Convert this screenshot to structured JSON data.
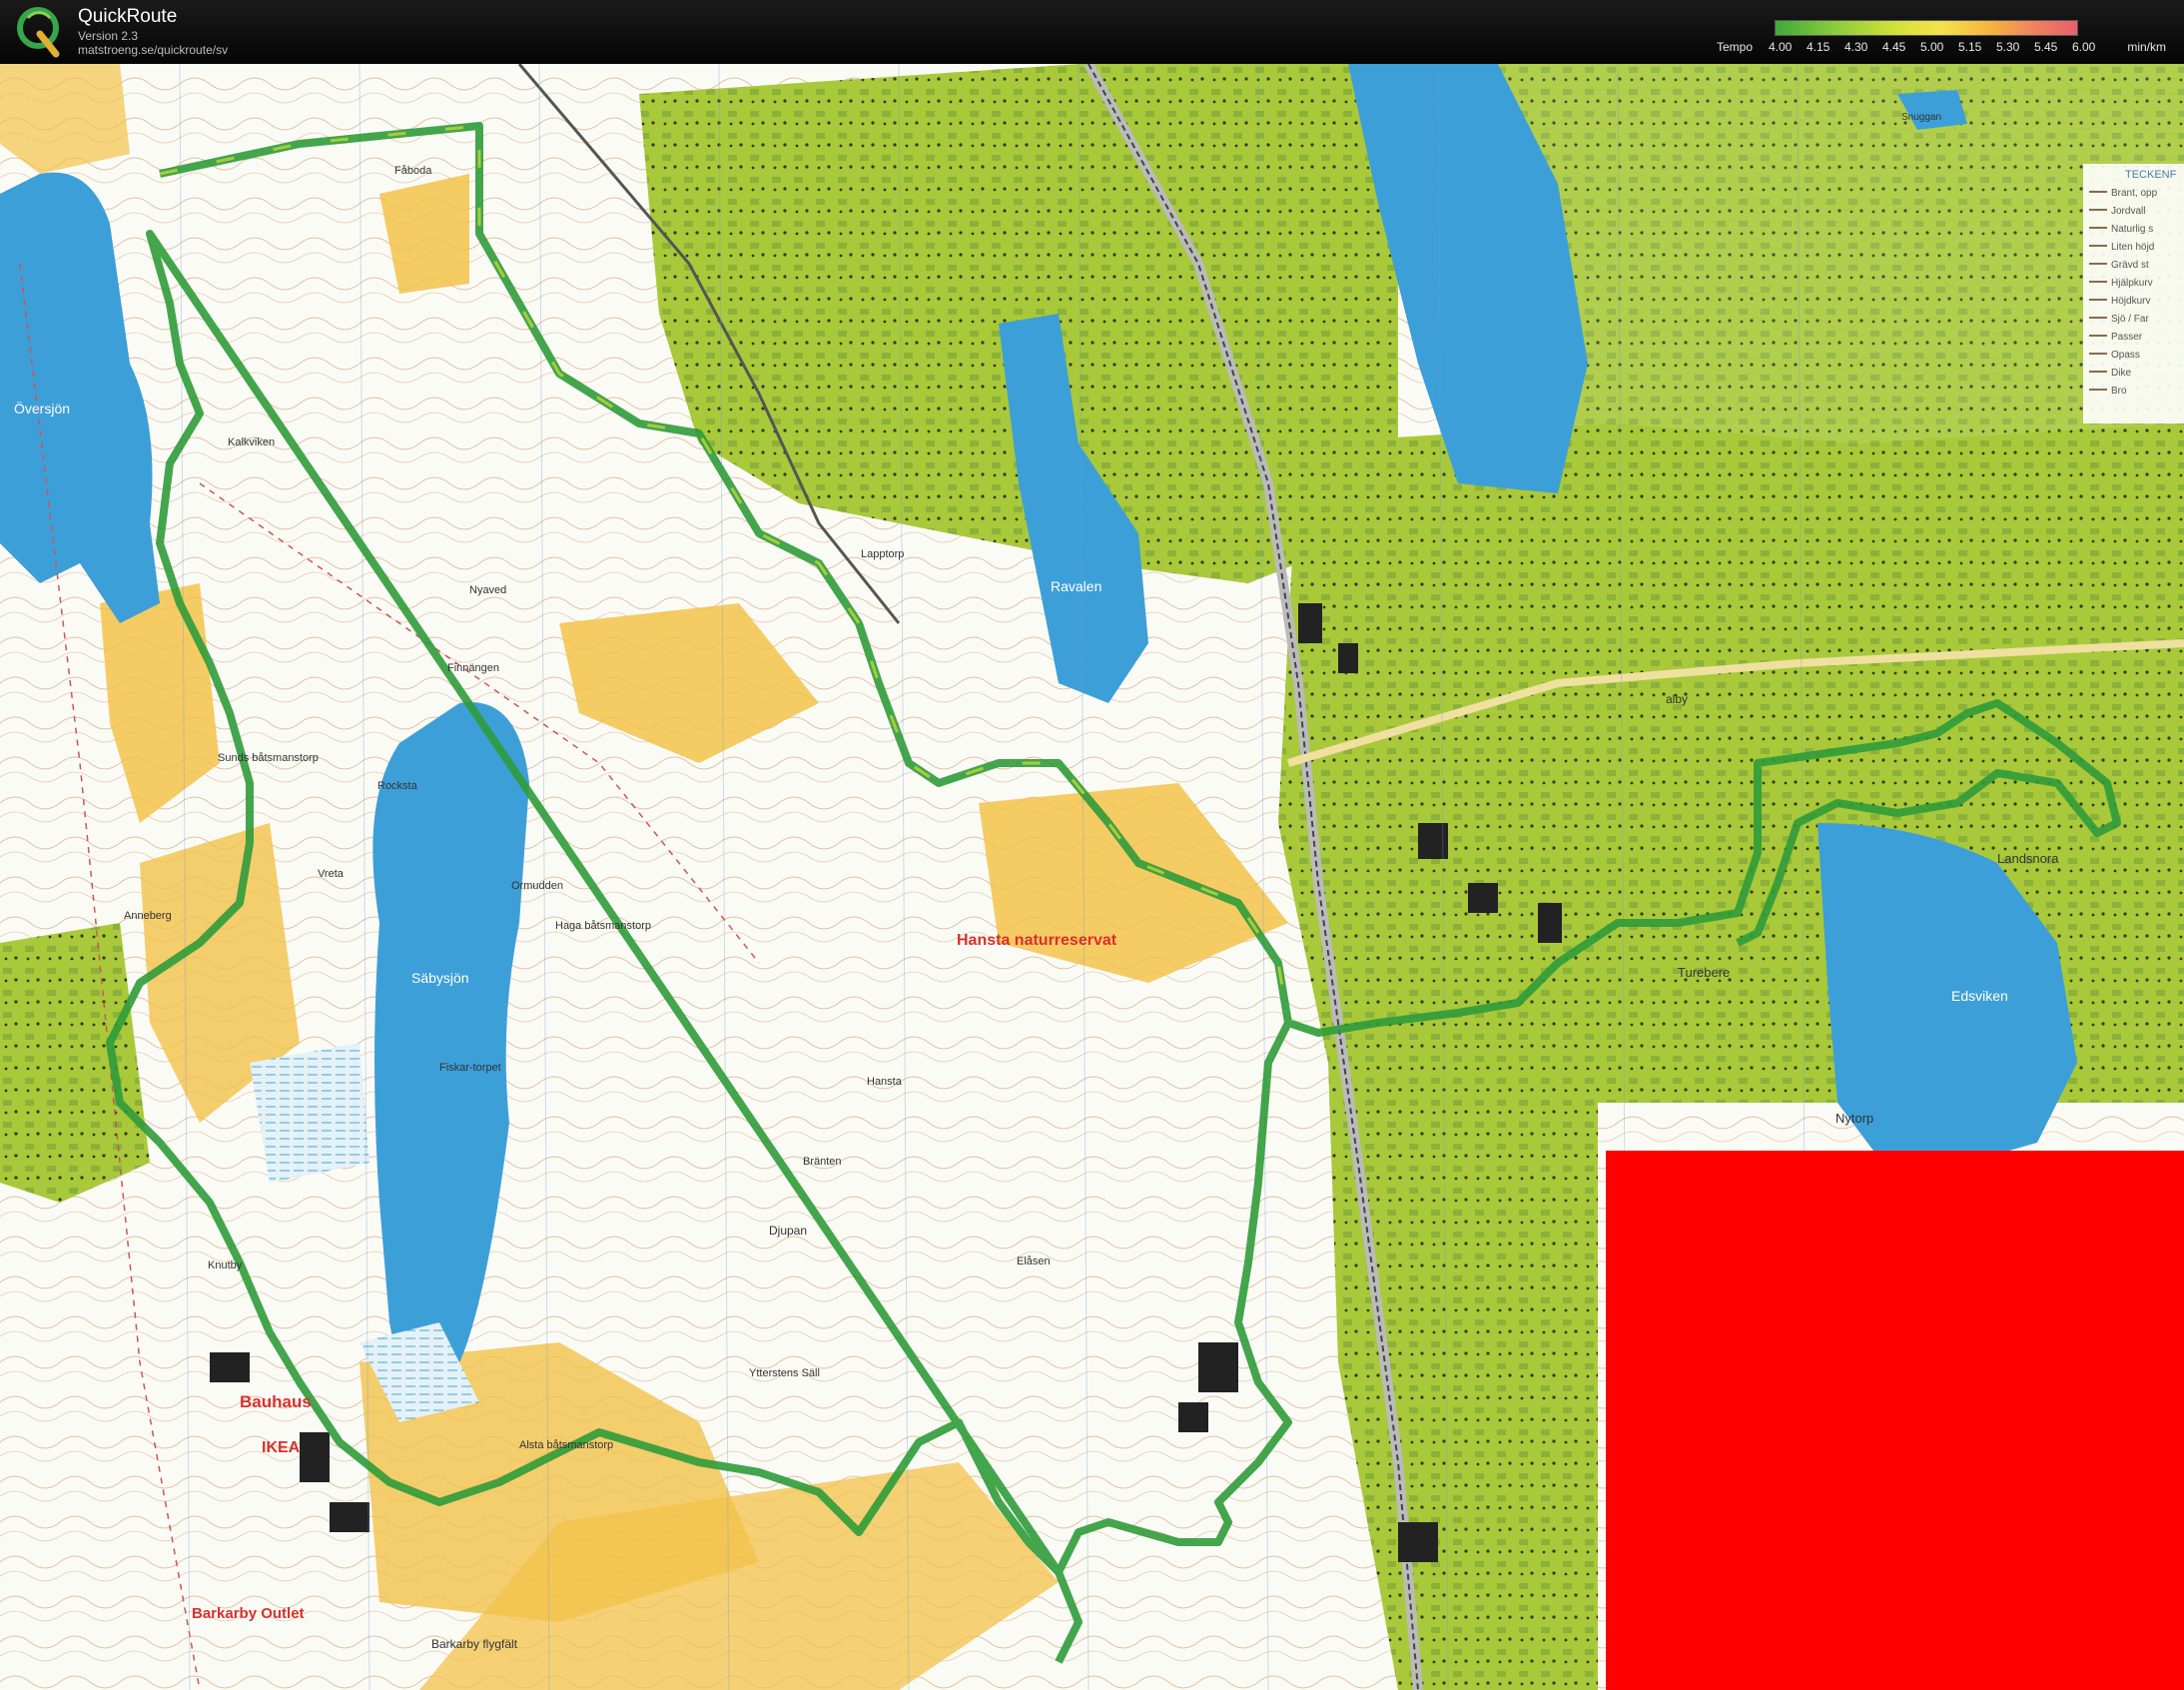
{
  "app": {
    "name": "QuickRoute",
    "version": "Version 2.3",
    "url": "matstroeng.se/quickroute/sv"
  },
  "legend": {
    "label": "Tempo",
    "unit": "min/km",
    "ticks": [
      "4.00",
      "4.15",
      "4.30",
      "4.45",
      "5.00",
      "5.15",
      "5.30",
      "5.45",
      "6.00"
    ]
  },
  "colors": {
    "route": "#2f9b3a",
    "water": "#3d9fd8",
    "open_land": "#f3c24a",
    "urban_green": "#a9c93a",
    "forest": "#ffffff",
    "redacted": "#ff0000"
  },
  "map": {
    "names": {
      "oversjon": "Översjön",
      "sabysjon": "Säbysjön",
      "ravalen": "Ravalen",
      "edsviken": "Edsviken",
      "hansta": "Hansta naturreservat",
      "bauhaus": "Bauhaus",
      "ikea": "IKEA",
      "barkarby_outlet": "Barkarby Outlet",
      "barkarby_flygfalt": "Barkarby flygfält",
      "djupan": "Djupan",
      "landsnora": "Landsnora",
      "nytorp": "Nytorp",
      "kalkviken": "Kalkviken",
      "faboda": "Fåboda",
      "lapptorp": "Lapptorp",
      "sunds_batsmanstorp": "Sunds båtsmanstorp",
      "vreta": "Vreta",
      "fiskartorpet": "Fiskar-torpet",
      "brantan": "Bränten",
      "elsasen": "Elåsen",
      "ormudden": "Ormudden",
      "haga_batsmanstorp": "Haga båtsmanstorp",
      "turebere": "Turebere",
      "teckenf": "TECKENF",
      "snuggan": "Snuggan",
      "alby": "alby",
      "hansta_small": "Hansta",
      "nyaved": "Nyaved",
      "finnangen": "Finnängen",
      "rocksta": "Rocksta",
      "anneberg": "Anneberg",
      "knutby": "Knutby",
      "akalla": "Alsta båtsmanstorp",
      "yttersten": "Ytterstens Säll"
    },
    "key_items": [
      "Brant, opp",
      "Jordvall",
      "Naturlig s",
      "Liten höjd",
      "Grävd st",
      "Hjälpkurv",
      "Höjdkurv",
      "Sjö / Far",
      "Passer",
      "Opass",
      "Dike",
      "Bro"
    ]
  }
}
